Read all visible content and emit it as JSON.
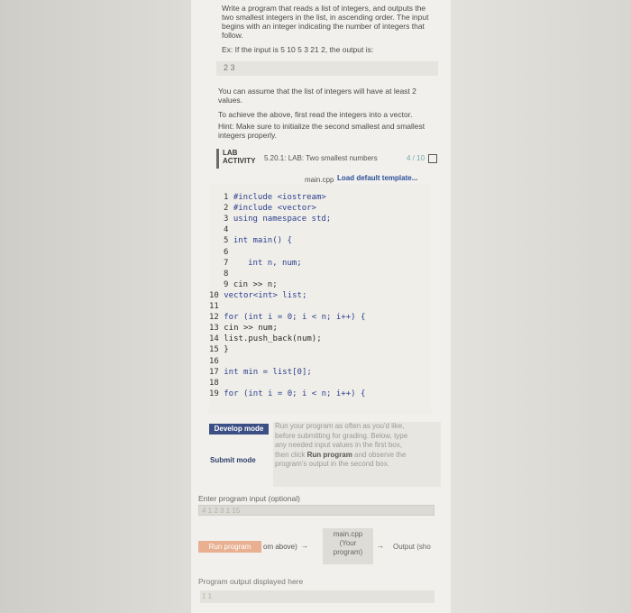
{
  "problem": {
    "line1": "Write a program that reads a list of integers, and outputs the",
    "line2": "two smallest integers in the list, in ascending order. The input",
    "line3": "begins with an integer indicating the number of integers that",
    "line4": "follow.",
    "example": "Ex: If the input is 5 10 5 3 21 2, the output is:",
    "example_output": "2 3",
    "assume1": "You can assume that the list of integers will have at least 2",
    "assume2": "values.",
    "achieve": "To achieve the above, first read the integers into a vector.",
    "hint1": "Hint: Make sure to initialize the second smallest and smallest",
    "hint2": "integers properly."
  },
  "lab": {
    "tag": "LAB ACTIVITY",
    "title": "5.20.1: LAB: Two smallest numbers",
    "score": "4 / 10"
  },
  "editor": {
    "filename": "main.cpp",
    "load_label": "Load default template...",
    "lines": [
      {
        "n": "1",
        "code": "#include <iostream>"
      },
      {
        "n": "2",
        "code": "#include <vector>"
      },
      {
        "n": "3",
        "code": "using namespace std;"
      },
      {
        "n": "4",
        "code": ""
      },
      {
        "n": "5",
        "code": "int main() {"
      },
      {
        "n": "6",
        "code": ""
      },
      {
        "n": "7",
        "code": "   int n, num;"
      },
      {
        "n": "8",
        "code": ""
      },
      {
        "n": "9",
        "code": "cin >> n;"
      },
      {
        "n": "10",
        "code": "vector<int> list;"
      },
      {
        "n": "11",
        "code": ""
      },
      {
        "n": "12",
        "code": "for (int i = 0; i < n; i++) {"
      },
      {
        "n": "13",
        "code": "cin >> num;"
      },
      {
        "n": "14",
        "code": "list.push_back(num);"
      },
      {
        "n": "15",
        "code": "}"
      },
      {
        "n": "16",
        "code": ""
      },
      {
        "n": "17",
        "code": "int min = list[0];"
      },
      {
        "n": "18",
        "code": ""
      },
      {
        "n": "19",
        "code": "for (int i = 0; i < n; i++) {"
      }
    ]
  },
  "modes": {
    "develop": "Develop mode",
    "submit": "Submit mode",
    "desc1": "Run your program as often as you'd like,",
    "desc2": "before submitting for grading. Below, type",
    "desc3": "any needed input values in the first box,",
    "desc4a": "then click ",
    "desc4b": "Run program",
    "desc4c": " and observe the",
    "desc5": "program's output in the second box."
  },
  "run": {
    "enter_label": "Enter program input (optional)",
    "input_value": "4 1 2 3 1 15",
    "run_button": "Run program",
    "from_text": "om above)",
    "main_box": [
      "main.cpp",
      "(Your",
      "program)"
    ],
    "output_label": "Output (sho",
    "output_displayed": "Program output displayed here",
    "output_value": "1 1"
  }
}
